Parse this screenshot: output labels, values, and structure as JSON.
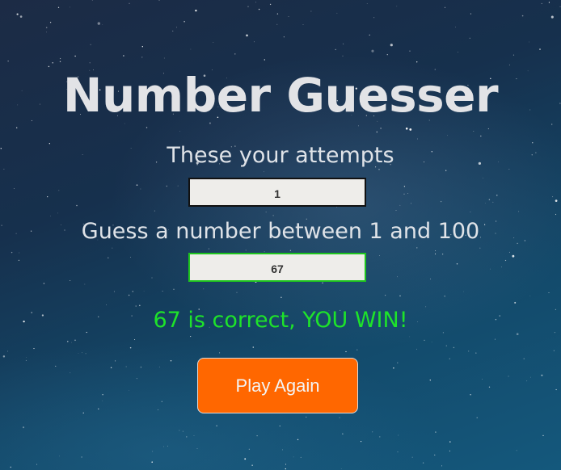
{
  "game": {
    "title": "Number Guesser",
    "attempts_label": "These your attempts",
    "attempts_value": "1",
    "guess_label": "Guess a number between 1 and 100",
    "guess_value": "67",
    "result_message": "67 is correct, YOU WIN!",
    "play_again_label": "Play Again"
  },
  "colors": {
    "title": "#e2e3e6",
    "win_message": "#1ee32a",
    "guess_border": "#1ec41e",
    "attempts_border": "#111111",
    "play_button": "#ff6700"
  }
}
